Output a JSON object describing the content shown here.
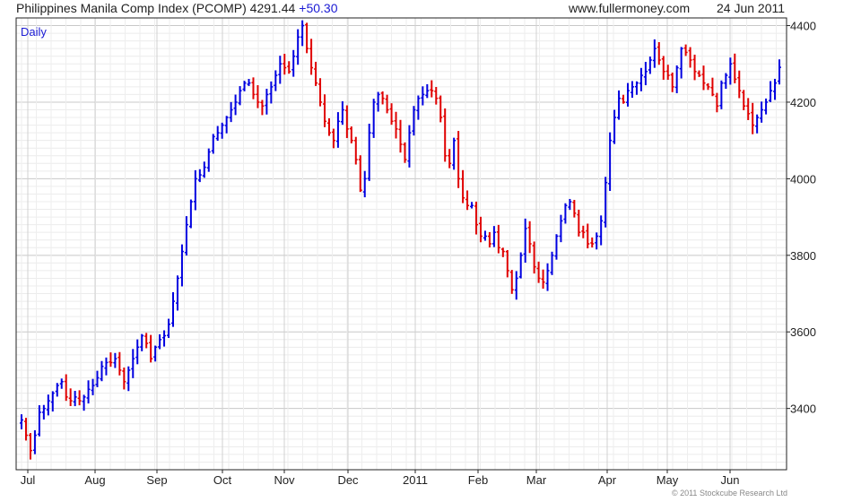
{
  "header": {
    "title": "Philippines Manila Comp Index (PCOMP) 4291.44",
    "change": "+50.30",
    "site": "www.fullermoney.com",
    "date": "24 Jun 2011"
  },
  "footer": {
    "copyright": "© 2011 Stockcube Research Ltd"
  },
  "chart_data": {
    "type": "ohlc",
    "label": "Daily",
    "ylim": [
      3240,
      4420
    ],
    "yticks": [
      3400,
      3600,
      3800,
      4000,
      4200,
      4400
    ],
    "xlabels": [
      "Jul",
      "Aug",
      "Sep",
      "Oct",
      "Nov",
      "Dec",
      "2011",
      "Feb",
      "Mar",
      "Apr",
      "May",
      "Jun"
    ],
    "grid": true,
    "up_color": "#0000e0",
    "down_color": "#e00000",
    "closes": [
      3370,
      3330,
      3290,
      3330,
      3390,
      3400,
      3420,
      3440,
      3460,
      3470,
      3430,
      3420,
      3430,
      3420,
      3430,
      3450,
      3460,
      3480,
      3510,
      3520,
      3520,
      3530,
      3500,
      3470,
      3500,
      3530,
      3560,
      3590,
      3570,
      3530,
      3560,
      3580,
      3590,
      3620,
      3680,
      3740,
      3810,
      3880,
      3940,
      4000,
      4010,
      4030,
      4070,
      4110,
      4120,
      4140,
      4160,
      4180,
      4200,
      4230,
      4250,
      4250,
      4220,
      4200,
      4190,
      4220,
      4240,
      4270,
      4300,
      4290,
      4280,
      4320,
      4370,
      4400,
      4340,
      4290,
      4250,
      4200,
      4150,
      4120,
      4100,
      4150,
      4180,
      4130,
      4100,
      4050,
      3970,
      4000,
      4120,
      4200,
      4220,
      4210,
      4180,
      4150,
      4130,
      4090,
      4050,
      4120,
      4180,
      4210,
      4220,
      4230,
      4230,
      4210,
      4160,
      4060,
      4040,
      4100,
      4000,
      3950,
      3930,
      3930,
      3880,
      3850,
      3850,
      3830,
      3860,
      3820,
      3810,
      3760,
      3710,
      3740,
      3800,
      3870,
      3830,
      3770,
      3740,
      3730,
      3760,
      3800,
      3850,
      3890,
      3930,
      3940,
      3910,
      3860,
      3860,
      3830,
      3830,
      3850,
      3890,
      3990,
      4100,
      4160,
      4210,
      4200,
      4230,
      4240,
      4250,
      4270,
      4280,
      4310,
      4340,
      4310,
      4280,
      4270,
      4240,
      4290,
      4340,
      4330,
      4310,
      4280,
      4270,
      4250,
      4240,
      4220,
      4190,
      4250,
      4270,
      4300,
      4260,
      4230,
      4190,
      4170,
      4140,
      4160,
      4180,
      4200,
      4230,
      4250,
      4291
    ]
  }
}
